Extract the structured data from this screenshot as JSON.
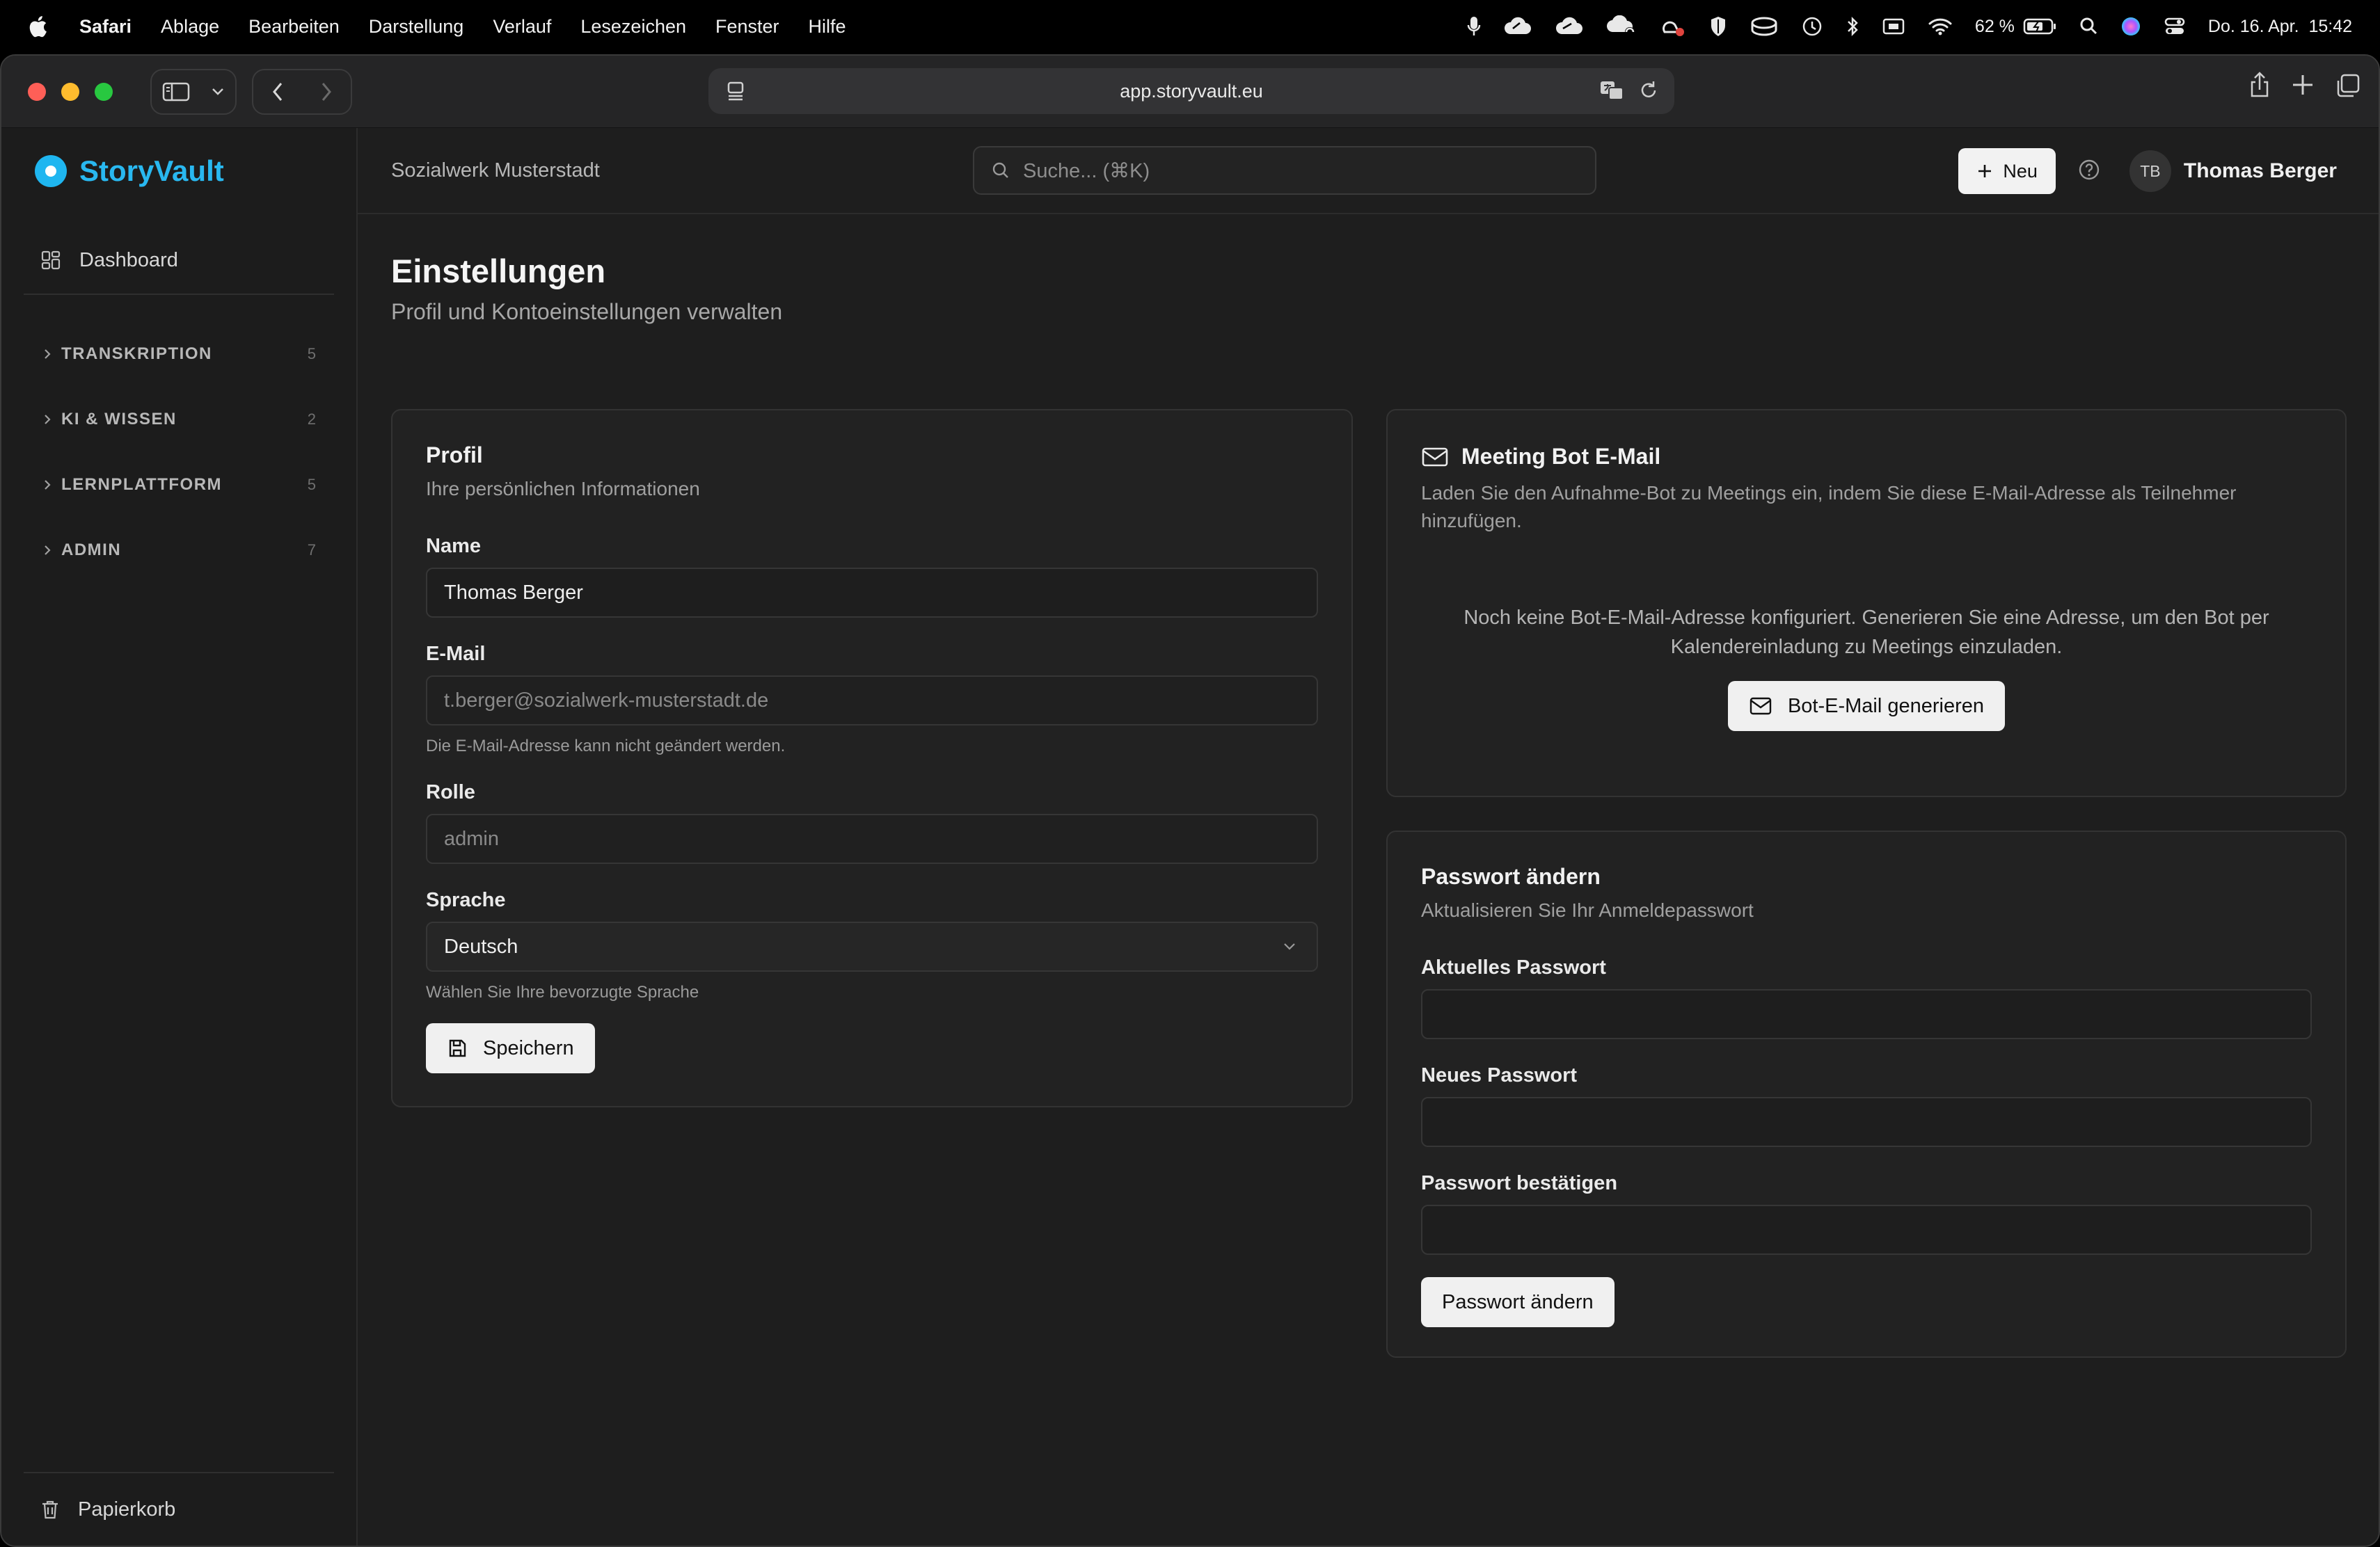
{
  "menubar": {
    "app": "Safari",
    "items": [
      "Ablage",
      "Bearbeiten",
      "Darstellung",
      "Verlauf",
      "Lesezeichen",
      "Fenster",
      "Hilfe"
    ],
    "battery": "62 %",
    "datetime": "Do. 16. Apr.  15:42"
  },
  "browser": {
    "url": "app.storyvault.eu"
  },
  "sidebar": {
    "brand": "StoryVault",
    "dashboard": "Dashboard",
    "sections": [
      {
        "label": "TRANSKRIPTION",
        "count": "5"
      },
      {
        "label": "KI & WISSEN",
        "count": "2"
      },
      {
        "label": "LERNPLATTFORM",
        "count": "5"
      },
      {
        "label": "ADMIN",
        "count": "7"
      }
    ],
    "trash": "Papierkorb"
  },
  "topbar": {
    "org": "Sozialwerk Musterstadt",
    "search_placeholder": "Suche... (⌘K)",
    "new_label": "Neu",
    "avatar_initials": "TB",
    "user_name": "Thomas Berger"
  },
  "page": {
    "title": "Einstellungen",
    "subtitle": "Profil und Kontoeinstellungen verwalten"
  },
  "profile": {
    "title": "Profil",
    "subtitle": "Ihre persönlichen Informationen",
    "name_label": "Name",
    "name_value": "Thomas Berger",
    "email_label": "E-Mail",
    "email_value": "t.berger@sozialwerk-musterstadt.de",
    "email_hint": "Die E-Mail-Adresse kann nicht geändert werden.",
    "role_label": "Rolle",
    "role_value": "admin",
    "language_label": "Sprache",
    "language_value": "Deutsch",
    "language_hint": "Wählen Sie Ihre bevorzugte Sprache",
    "save_label": "Speichern"
  },
  "bot": {
    "title": "Meeting Bot E-Mail",
    "subtitle": "Laden Sie den Aufnahme-Bot zu Meetings ein, indem Sie diese E-Mail-Adresse als Teilnehmer hinzufügen.",
    "empty_message": "Noch keine Bot-E-Mail-Adresse konfiguriert. Generieren Sie eine Adresse, um den Bot per Kalendereinladung zu Meetings einzuladen.",
    "generate_label": "Bot-E-Mail generieren"
  },
  "password": {
    "title": "Passwort ändern",
    "subtitle": "Aktualisieren Sie Ihr Anmeldepasswort",
    "current_label": "Aktuelles Passwort",
    "new_label": "Neues Passwort",
    "confirm_label": "Passwort bestätigen",
    "submit_label": "Passwort ändern"
  },
  "colors": {
    "brand": "#29b8f0",
    "background": "#1e1e1e",
    "card": "#222222"
  }
}
